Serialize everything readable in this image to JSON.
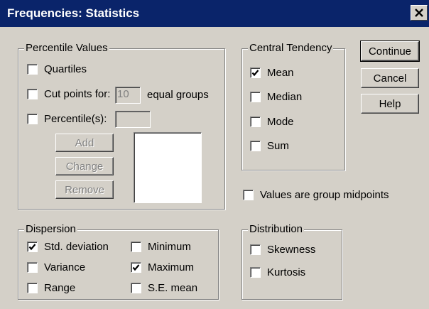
{
  "window": {
    "title": "Frequencies: Statistics"
  },
  "percentile_values": {
    "title": "Percentile Values",
    "quartiles": {
      "label": "Quartiles",
      "checked": false
    },
    "cut_points": {
      "label": "Cut points for:",
      "value": "10",
      "suffix": "equal groups",
      "checked": false
    },
    "percentiles": {
      "label": "Percentile(s):",
      "value": "",
      "checked": false
    },
    "buttons": {
      "add": "Add",
      "change": "Change",
      "remove": "Remove"
    }
  },
  "central_tendency": {
    "title": "Central Tendency",
    "items": [
      {
        "label": "Mean",
        "checked": true
      },
      {
        "label": "Median",
        "checked": false
      },
      {
        "label": "Mode",
        "checked": false
      },
      {
        "label": "Sum",
        "checked": false
      }
    ]
  },
  "actions": {
    "continue": "Continue",
    "cancel": "Cancel",
    "help": "Help"
  },
  "group_midpoints": {
    "label": "Values are group midpoints",
    "checked": false
  },
  "dispersion": {
    "title": "Dispersion",
    "items": [
      {
        "label": "Std. deviation",
        "checked": true
      },
      {
        "label": "Variance",
        "checked": false
      },
      {
        "label": "Range",
        "checked": false
      },
      {
        "label": "Minimum",
        "checked": false
      },
      {
        "label": "Maximum",
        "checked": true
      },
      {
        "label": "S.E. mean",
        "checked": false
      }
    ]
  },
  "distribution": {
    "title": "Distribution",
    "items": [
      {
        "label": "Skewness",
        "checked": false
      },
      {
        "label": "Kurtosis",
        "checked": false
      }
    ]
  }
}
